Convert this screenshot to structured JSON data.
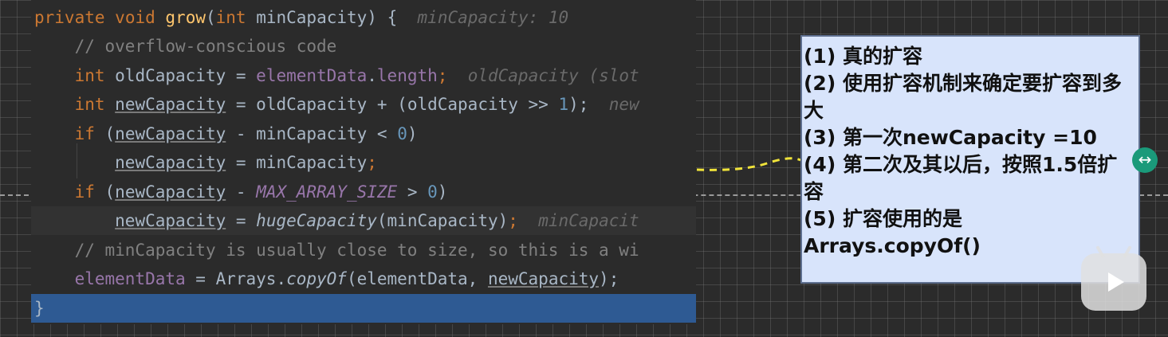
{
  "code": {
    "l1": {
      "kw1": "private",
      "kw2": "void",
      "fn": "grow",
      "p1": "(",
      "kw3": "int",
      "p2": " minCapacity) {",
      "hint": "minCapacity: 10"
    },
    "l2": {
      "cmt": "// overflow-conscious code"
    },
    "l3": {
      "kw": "int",
      "id": " oldCapacity = ",
      "fld": "elementData",
      "p": ".",
      "fld2": "length",
      "semi": ";",
      "hint": "oldCapacity (slot"
    },
    "l4": {
      "kw": "int",
      "id": "newCapacity",
      "p1": " = oldCapacity + (oldCapacity >> ",
      "num": "1",
      "p2": ");",
      "hint": "new"
    },
    "l5": {
      "kw": "if",
      "p1": " (",
      "id": "newCapacity",
      "p2": " - minCapacity < ",
      "num": "0",
      "p3": ")"
    },
    "l6": {
      "id": "newCapacity",
      "p": " = minCapacity",
      "semi": ";"
    },
    "l7": {
      "kw": "if",
      "p1": " (",
      "id": "newCapacity",
      "p2": " - ",
      "cst": "MAX_ARRAY_SIZE",
      "p3": " > ",
      "num": "0",
      "p4": ")"
    },
    "l8": {
      "id": "newCapacity",
      "p1": " = ",
      "it": "hugeCapacity",
      "p2": "(minCapacity)",
      "semi": ";",
      "hint": "minCapacit"
    },
    "l9": {
      "cmt": "// minCapacity is usually close to size, so this is a wi"
    },
    "l10": {
      "fld": "elementData",
      "p1": " = Arrays.",
      "it": "copyOf",
      "p2": "(elementData, ",
      "id": "newCapacity",
      "p3": ");"
    },
    "l11": {
      "brace": "}"
    }
  },
  "note": {
    "lines": [
      "(1) 真的扩容",
      "(2) 使用扩容机制来确定要扩容到多大",
      "(3) 第一次newCapacity =10",
      "(4) 第二次及其以后，按照1.5倍扩容",
      "(5) 扩容使用的是 Arrays.copyOf()"
    ],
    "bg_color": "#d8e4fb"
  },
  "icons": {
    "resize": "resize-horizontal-icon",
    "player": "video-player-icon"
  },
  "glyphs": {
    "resize": "↔"
  },
  "colors": {
    "keyword": "#cc7832",
    "function": "#ffc66d",
    "field": "#9876aa",
    "number": "#6897bb",
    "comment": "#808080",
    "selection": "#2e5a93",
    "arrow": "#f0e33a"
  }
}
